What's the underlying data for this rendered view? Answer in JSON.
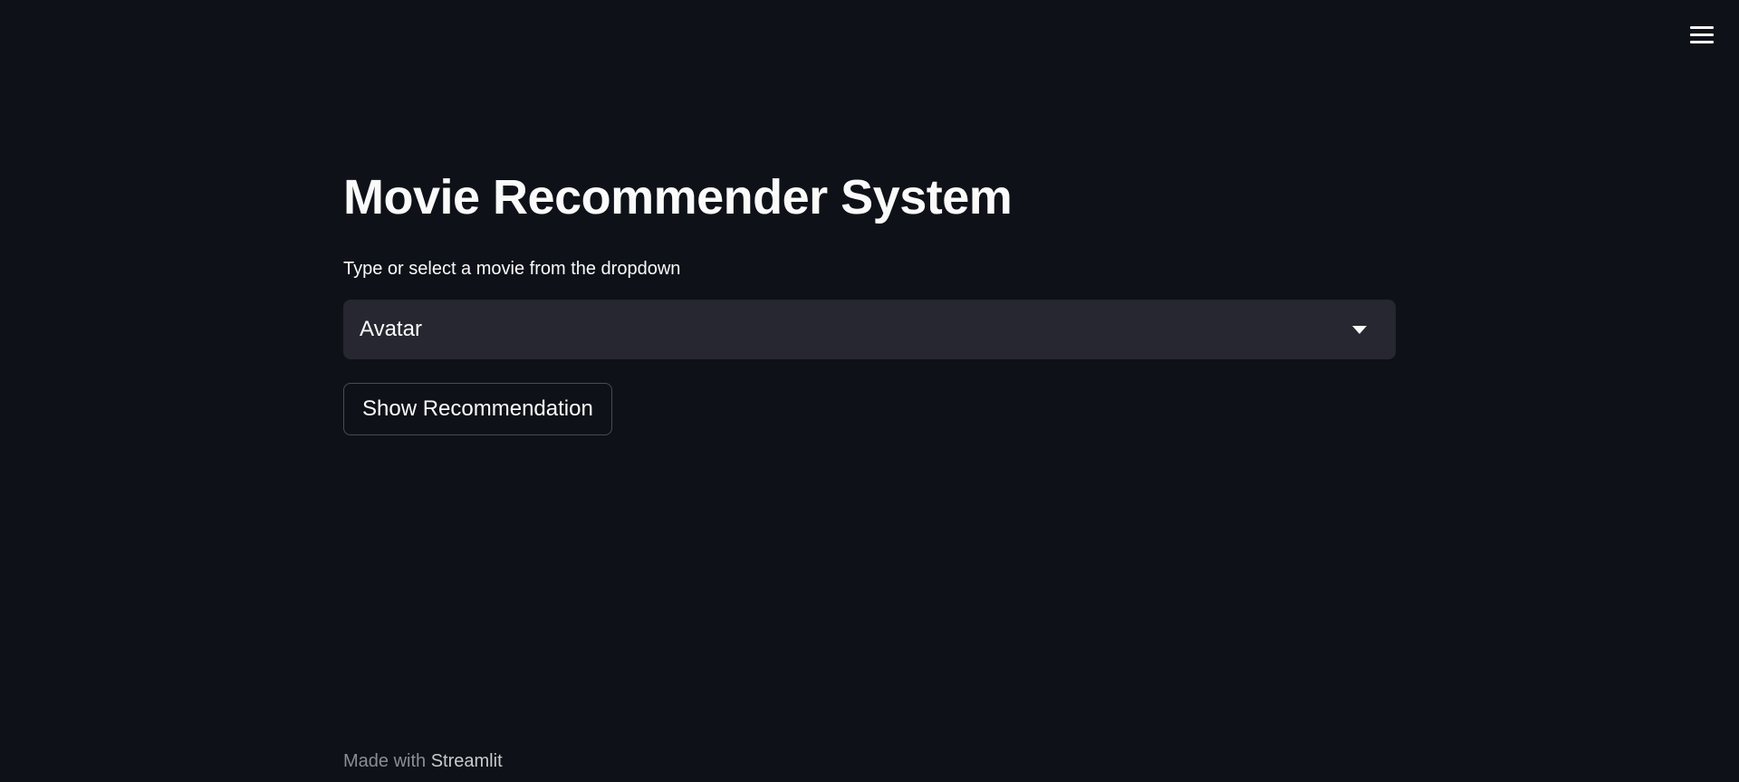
{
  "menu": {
    "icon": "hamburger-menu-icon"
  },
  "main": {
    "title": "Movie Recommender System",
    "select_label": "Type or select a movie from the dropdown",
    "select_value": "Avatar",
    "button_label": "Show Recommendation"
  },
  "footer": {
    "prefix": "Made with",
    "brand": "Streamlit"
  },
  "colors": {
    "background": "#0e1117",
    "input_background": "#262730",
    "text": "#fafafa",
    "muted": "#8c8d92"
  }
}
